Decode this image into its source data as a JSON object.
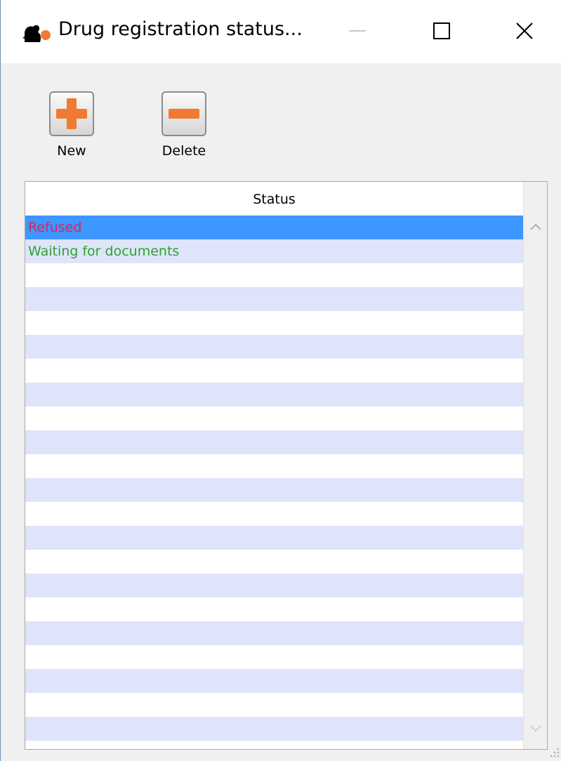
{
  "window": {
    "title": "Drug registration status..."
  },
  "toolbar": {
    "new_label": "New",
    "delete_label": "Delete"
  },
  "table": {
    "column_header": "Status",
    "rows": [
      {
        "text": "Refused",
        "color": "#e0205a",
        "selected": true
      },
      {
        "text": "Waiting for documents",
        "color": "#2ea22e",
        "selected": false
      }
    ]
  },
  "colors": {
    "selection": "#3d97ff",
    "stripe": "#dfe4fb",
    "icon_orange": "#f07a30"
  }
}
